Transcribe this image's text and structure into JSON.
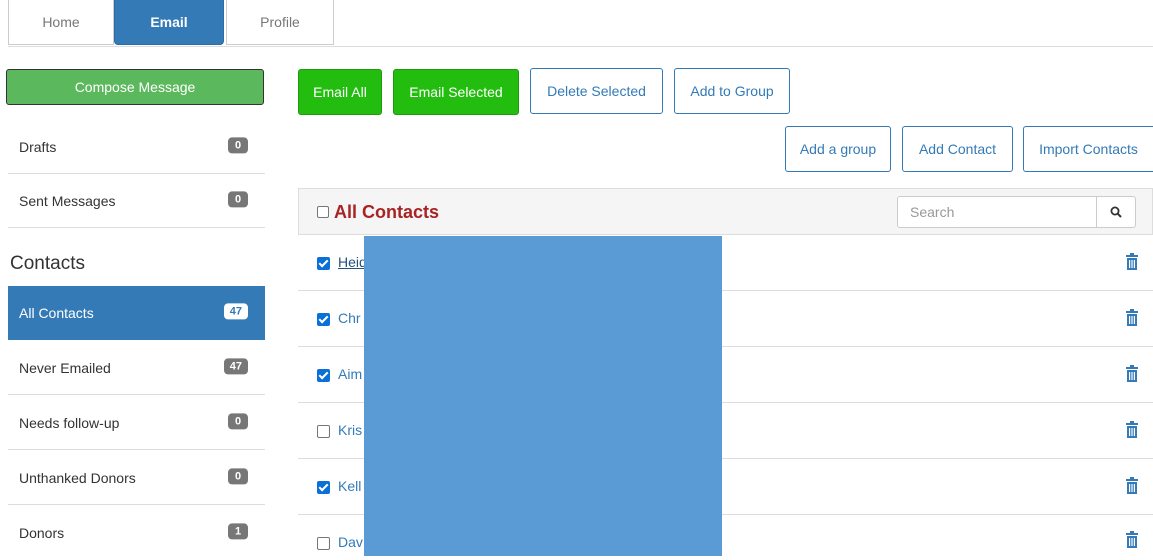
{
  "tabs": {
    "home": "Home",
    "email": "Email",
    "profile": "Profile"
  },
  "sidebar": {
    "compose": "Compose Message",
    "drafts": {
      "label": "Drafts",
      "count": "0"
    },
    "sent": {
      "label": "Sent Messages",
      "count": "0"
    },
    "contacts_heading": "Contacts",
    "groups": [
      {
        "label": "All Contacts",
        "count": "47"
      },
      {
        "label": "Never Emailed",
        "count": "47"
      },
      {
        "label": "Needs follow-up",
        "count": "0"
      },
      {
        "label": "Unthanked Donors",
        "count": "0"
      },
      {
        "label": "Donors",
        "count": "1"
      }
    ]
  },
  "toolbar": {
    "email_all": "Email All",
    "email_selected": "Email Selected",
    "delete_selected": "Delete Selected",
    "add_to_group": "Add to Group",
    "add_group": "Add a group",
    "add_contact": "Add Contact",
    "import_contacts": "Import Contacts"
  },
  "list": {
    "title": "All Contacts",
    "search_placeholder": "Search",
    "rows": [
      {
        "name": "Heid",
        "checked": true
      },
      {
        "name": "Chr",
        "checked": true
      },
      {
        "name": "Aim",
        "checked": true
      },
      {
        "name": "Kris",
        "checked": false
      },
      {
        "name": "Kell",
        "checked": true
      },
      {
        "name": "Dav",
        "checked": false
      }
    ]
  },
  "colors": {
    "primary": "#337ab7",
    "green": "#23bd10",
    "compose": "#5cb85c",
    "title_red": "#a82323"
  }
}
